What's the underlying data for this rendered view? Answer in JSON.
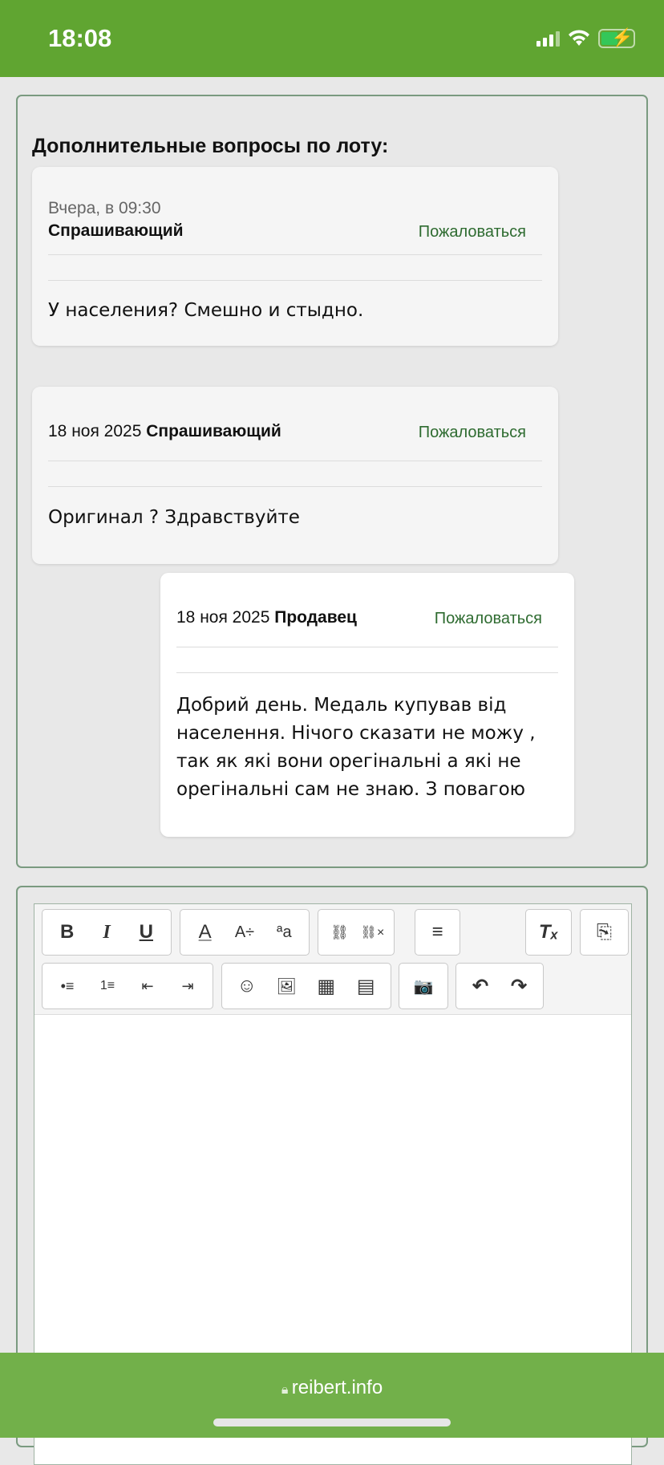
{
  "status_bar": {
    "time": "18:08"
  },
  "section_title": "Дополнительные вопросы по лоту:",
  "report_label": "Пожаловаться",
  "comments": [
    {
      "date": "Вчера, в 09:30",
      "author": "Спрашивающий",
      "text": "У населения? Смешно и стыдно."
    },
    {
      "date": "18 ноя 2025",
      "author": "Спрашивающий",
      "text": "Оригинал ? Здравствуйте"
    },
    {
      "date": "18 ноя 2025",
      "author": "Продавец",
      "text": "Добрий день. Медаль купував від населення. Нічого сказати не можу , так як які вони орегінальні а які не орегінальні сам не знаю. З повагою"
    }
  ],
  "toolbar": {
    "bold": "B",
    "italic": "I",
    "underline": "U",
    "font_color": "A",
    "font_size": "A÷",
    "font_style": "ªa",
    "link": "⛓",
    "unlink": "⛓×",
    "align": "≡",
    "clear_format": "Tₓ",
    "source": "⎘",
    "bullets": "•≡",
    "numbers": "1≡",
    "outdent": "⇤",
    "indent": "⇥",
    "smiley": "☺",
    "image": "🖼",
    "media": "▦",
    "template": "▤",
    "camera": "📷",
    "undo": "↶",
    "redo": "↷"
  },
  "browser": {
    "url": "reibert.info"
  }
}
